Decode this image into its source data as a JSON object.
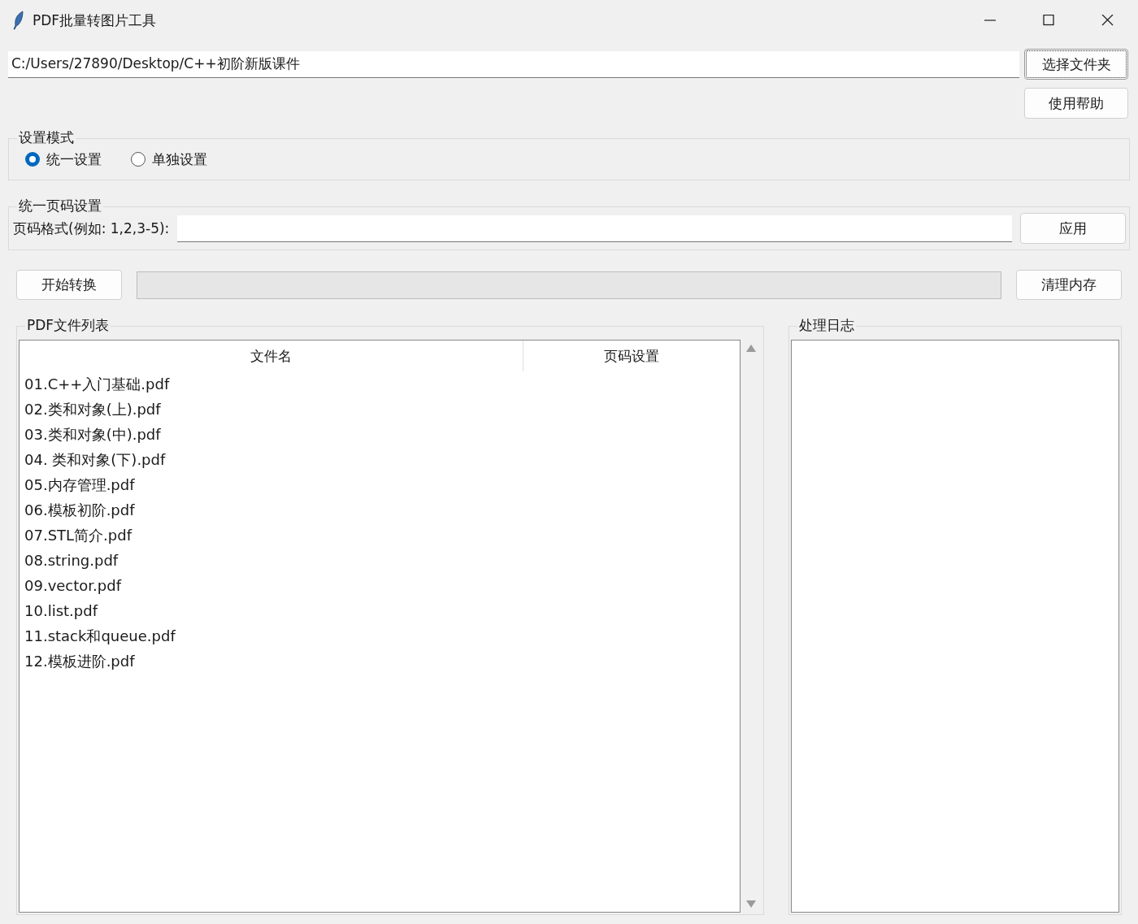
{
  "window": {
    "title": "PDF批量转图片工具"
  },
  "folder": {
    "path": "C:/Users/27890/Desktop/C++初阶新版课件",
    "button": "选择文件夹"
  },
  "help_button": "使用帮助",
  "mode": {
    "title": "设置模式",
    "options": [
      {
        "label": "统一设置",
        "selected": true
      },
      {
        "label": "单独设置",
        "selected": false
      }
    ]
  },
  "unified": {
    "title": "统一页码设置",
    "label": "页码格式(例如: 1,2,3-5):",
    "button": "应用"
  },
  "actions": {
    "start": "开始转换",
    "progress": {
      "level": 0
    },
    "clear": "清理内存"
  },
  "file_list": {
    "title": "PDF文件列表",
    "columns": [
      "文件名",
      "页码设置"
    ],
    "rows": [
      {
        "name": "01.C++入门基础.pdf"
      },
      {
        "name": "02.类和对象(上).pdf"
      },
      {
        "name": "03.类和对象(中).pdf"
      },
      {
        "name": "04. 类和对象(下).pdf"
      },
      {
        "name": "05.内存管理.pdf"
      },
      {
        "name": "06.模板初阶.pdf"
      },
      {
        "name": "07.STL简介.pdf"
      },
      {
        "name": "08.string.pdf"
      },
      {
        "name": "09.vector.pdf"
      },
      {
        "name": "10.list.pdf"
      },
      {
        "name": "11.stack和queue.pdf"
      },
      {
        "name": "12.模板进阶.pdf"
      }
    ]
  },
  "log": {
    "title": "处理日志"
  }
}
